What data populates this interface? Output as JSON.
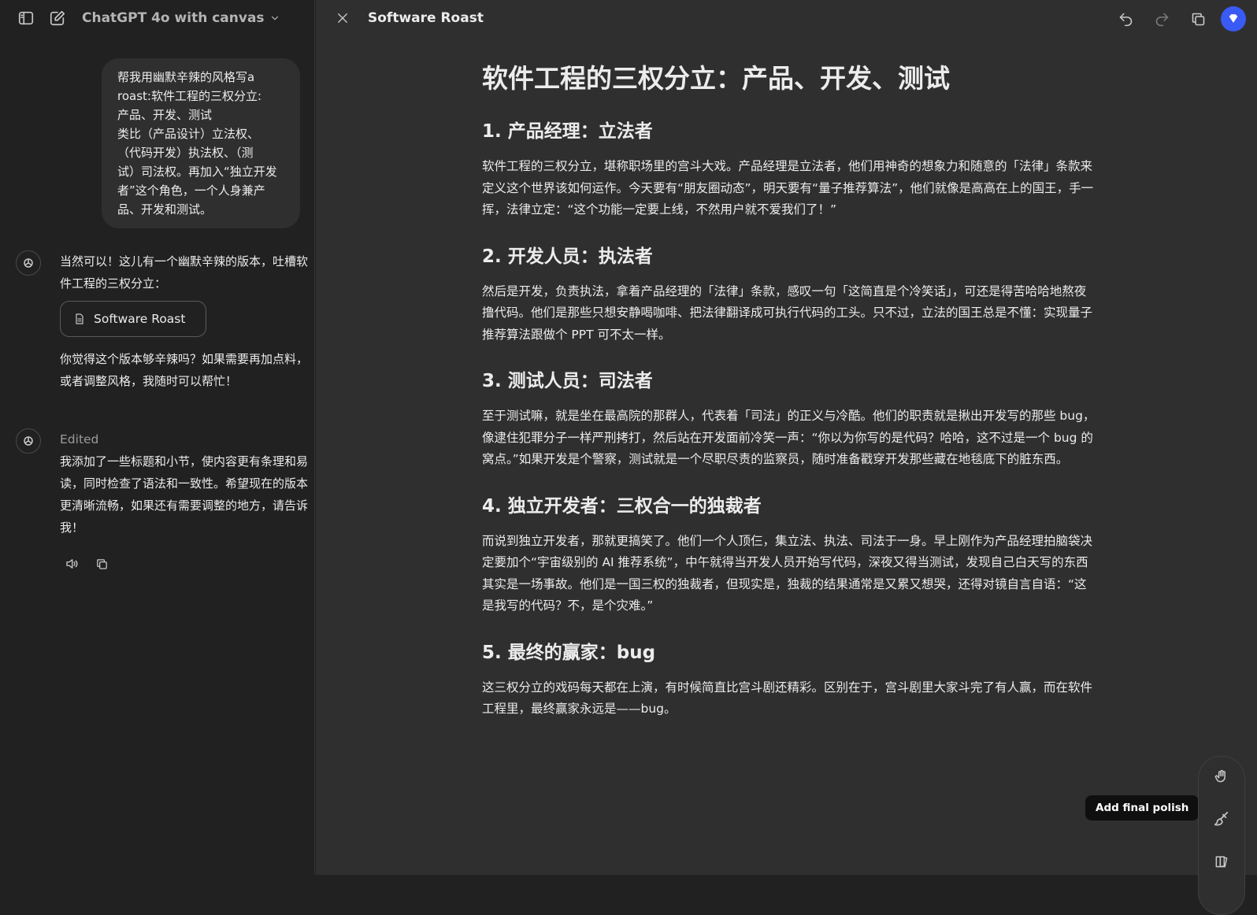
{
  "header": {
    "model_name": "ChatGPT 4o with canvas"
  },
  "chat": {
    "user_message": "帮我用幽默辛辣的风格写a\nroast:软件工程的三权分立:\n产品、开发、测试\n类比（产品设计）立法权、\n（代码开发）执法权、（测\n试）司法权。再加入“独立开发\n者”这个角色，一个人身兼产\n品、开发和测试。",
    "assistant_1": {
      "text_before": "当然可以！这儿有一个幽默辛辣的版本，吐槽软件工程的三权分立：",
      "canvas_chip_label": "Software Roast",
      "text_after": "你觉得这个版本够辛辣吗？如果需要再加点料，或者调整风格，我随时可以帮忙！"
    },
    "assistant_2": {
      "edited_label": "Edited",
      "text": "我添加了一些标题和小节，使内容更有条理和易读，同时检查了语法和一致性。希望现在的版本更清晰流畅，如果还有需要调整的地方，请告诉我！"
    }
  },
  "canvas": {
    "title": "Software Roast",
    "doc": {
      "h1": "软件工程的三权分立：产品、开发、测试",
      "sections": [
        {
          "heading": "1. 产品经理：立法者",
          "body": "软件工程的三权分立，堪称职场里的宫斗大戏。产品经理是立法者，他们用神奇的想象力和随意的「法律」条款来定义这个世界该如何运作。今天要有“朋友圈动态”，明天要有“量子推荐算法”，他们就像是高高在上的国王，手一挥，法律立定：“这个功能一定要上线，不然用户就不爱我们了！”"
        },
        {
          "heading": "2. 开发人员：执法者",
          "body": "然后是开发，负责执法，拿着产品经理的「法律」条款，感叹一句「这简直是个冷笑话」，可还是得苦哈哈地熬夜撸代码。他们是那些只想安静喝咖啡、把法律翻译成可执行代码的工头。只不过，立法的国王总是不懂：实现量子推荐算法跟做个 PPT 可不太一样。"
        },
        {
          "heading": "3. 测试人员：司法者",
          "body": "至于测试嘛，就是坐在最高院的那群人，代表着「司法」的正义与冷酷。他们的职责就是揪出开发写的那些 bug，像逮住犯罪分子一样严刑拷打，然后站在开发面前冷笑一声：“你以为你写的是代码？哈哈，这不过是一个 bug 的窝点。”如果开发是个警察，测试就是一个尽职尽责的监察员，随时准备戳穿开发那些藏在地毯底下的脏东西。"
        },
        {
          "heading": "4. 独立开发者：三权合一的独裁者",
          "body": "而说到独立开发者，那就更搞笑了。他们一个人顶仨，集立法、执法、司法于一身。早上刚作为产品经理拍脑袋决定要加个“宇宙级别的 AI 推荐系统”，中午就得当开发人员开始写代码，深夜又得当测试，发现自己白天写的东西其实是一场事故。他们是一国三权的独裁者，但现实是，独裁的结果通常是又累又想哭，还得对镜自言自语：“这是我写的代码？不，是个灾难。”"
        },
        {
          "heading": "5. 最终的赢家：bug",
          "body": "这三权分立的戏码每天都在上演，有时候简直比宫斗剧还精彩。区别在于，宫斗剧里大家斗完了有人赢，而在软件工程里，最终赢家永远是——bug。"
        }
      ]
    },
    "tooltip": "Add final polish"
  },
  "icons": {
    "toggle_sidebar": "sidebar-toggle-icon",
    "new_chat": "new-chat-icon",
    "model_chevron": "chevron-down-icon",
    "close": "close-icon",
    "undo": "undo-icon",
    "redo": "redo-icon",
    "copy": "copy-icon",
    "read_aloud": "speaker-icon",
    "suggest_edits": "hand-icon",
    "final_polish": "paintbrush-icon",
    "reading_level": "book-icon",
    "document": "document-icon",
    "openai_logo": "openai-logo-icon"
  },
  "colors": {
    "sidebar_bg": "#212121",
    "canvas_bg": "#2f2f2f",
    "text": "#ececec",
    "muted": "#9b9b9b",
    "avatar_accent": "#3a5af4",
    "tooltip_bg": "#0f0f0f"
  }
}
